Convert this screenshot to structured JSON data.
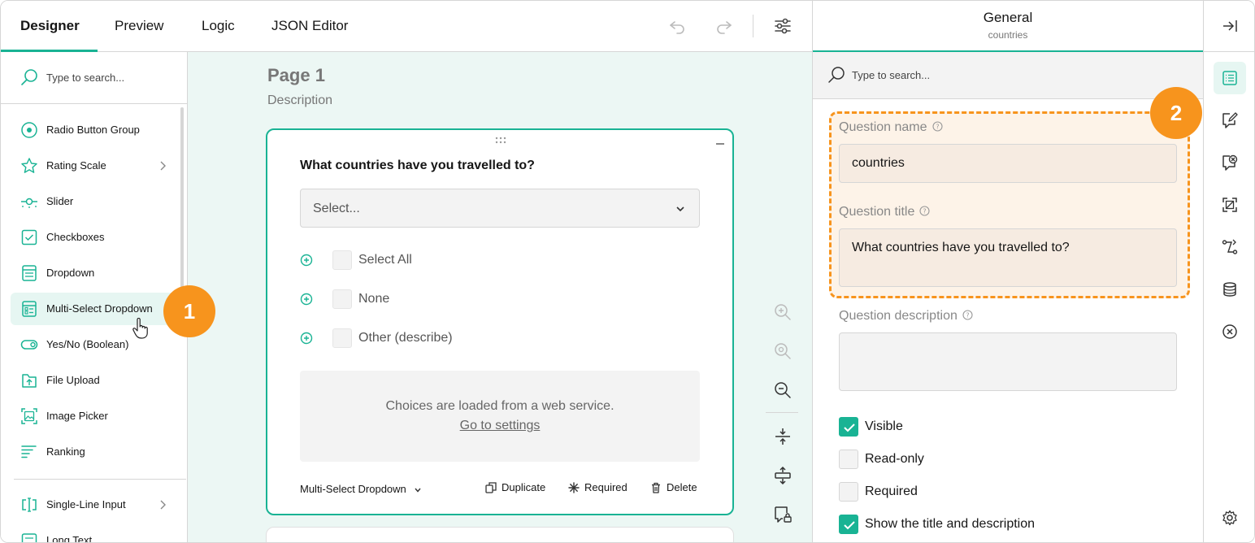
{
  "tabs": [
    {
      "label": "Designer",
      "active": true
    },
    {
      "label": "Preview",
      "active": false
    },
    {
      "label": "Logic",
      "active": false
    },
    {
      "label": "JSON Editor",
      "active": false
    }
  ],
  "toolbox": {
    "search_placeholder": "Type to search...",
    "items": [
      {
        "label": "Radio Button Group",
        "icon": "radio-icon"
      },
      {
        "label": "Rating Scale",
        "icon": "star-icon",
        "has_submenu": true
      },
      {
        "label": "Slider",
        "icon": "slider-icon"
      },
      {
        "label": "Checkboxes",
        "icon": "checkbox-icon"
      },
      {
        "label": "Dropdown",
        "icon": "dropdown-icon"
      },
      {
        "label": "Multi-Select Dropdown",
        "icon": "multi-select-icon",
        "hovered": true
      },
      {
        "label": "Yes/No (Boolean)",
        "icon": "toggle-icon"
      },
      {
        "label": "File Upload",
        "icon": "file-upload-icon"
      },
      {
        "label": "Image Picker",
        "icon": "image-picker-icon"
      },
      {
        "label": "Ranking",
        "icon": "ranking-icon"
      },
      {
        "label": "Single-Line Input",
        "icon": "text-input-icon",
        "has_submenu": true
      },
      {
        "label": "Long Text",
        "icon": "long-text-icon"
      }
    ]
  },
  "canvas": {
    "page_title": "Page 1",
    "page_description": "Description",
    "question": {
      "title": "What countries have you travelled to?",
      "select_placeholder": "Select...",
      "choices": [
        "Select All",
        "None",
        "Other (describe)"
      ],
      "webservice_message": "Choices are loaded from a web service.",
      "webservice_link": "Go to settings",
      "type_label": "Multi-Select Dropdown",
      "actions": {
        "duplicate": "Duplicate",
        "required": "Required",
        "delete": "Delete"
      }
    }
  },
  "properties": {
    "header_title": "General",
    "header_subtitle": "countries",
    "search_placeholder": "Type to search...",
    "question_name_label": "Question name",
    "question_name_value": "countries",
    "question_title_label": "Question title",
    "question_title_value": "What countries have you travelled to?",
    "question_description_label": "Question description",
    "question_description_value": "",
    "checkboxes": [
      {
        "label": "Visible",
        "checked": true
      },
      {
        "label": "Read-only",
        "checked": false
      },
      {
        "label": "Required",
        "checked": false
      },
      {
        "label": "Show the title and description",
        "checked": true
      }
    ]
  },
  "callouts": [
    "1",
    "2"
  ],
  "colors": {
    "accent": "#19b394",
    "callout": "#f7941d",
    "canvas_bg": "#ecf7f4"
  }
}
